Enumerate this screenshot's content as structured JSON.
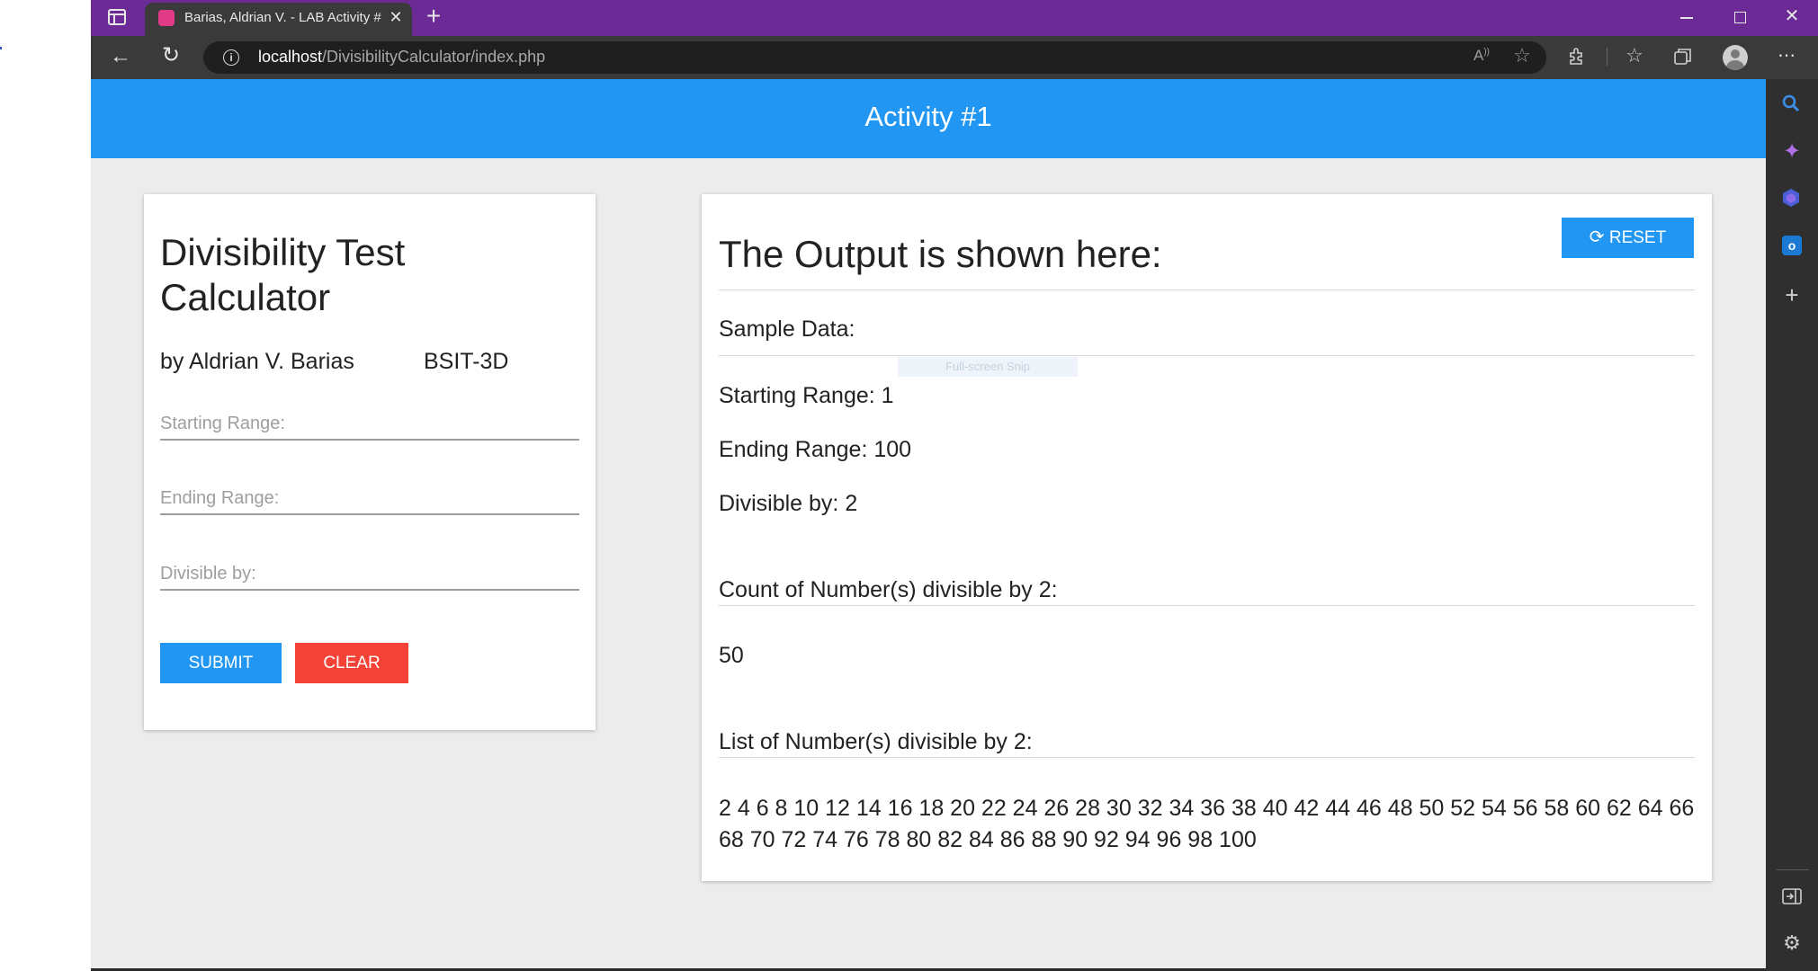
{
  "browser": {
    "tab_title": "Barias, Aldrian V. - LAB Activity #",
    "url_host": "localhost",
    "url_path": "/DivisibilityCalculator/index.php",
    "snip_label": "Full-screen Snip"
  },
  "app": {
    "header_title": "Activity #1"
  },
  "form": {
    "title_line1": "Divisibility Test",
    "title_line2": "Calculator",
    "author": "by Aldrian V. Barias",
    "section": "BSIT-3D",
    "starting_placeholder": "Starting Range:",
    "ending_placeholder": "Ending Range:",
    "divisible_placeholder": "Divisible by:",
    "submit_label": "SUBMIT",
    "clear_label": "CLEAR"
  },
  "output": {
    "title": "The Output is shown here:",
    "reset_label": "RESET",
    "sample_heading": "Sample Data:",
    "starting": "Starting Range: 1",
    "ending": "Ending Range: 100",
    "divisible": "Divisible by: 2",
    "count_heading": "Count of Number(s) divisible by 2:",
    "count_value": "50",
    "list_heading": "List of Number(s) divisible by 2:",
    "list_line1": "2 4 6 8 10 12 14 16 18 20 22 24 26 28 30 32 34 36 38 40 42 44 46 48 50 52 54 56 58 60 62 64 66",
    "list_line2": "68 70 72 74 76 78 80 82 84 86 88 90 92 94 96 98 100"
  },
  "colors": {
    "browser_accent": "#6b2a96",
    "header_blue": "#2196f3",
    "clear_red": "#f44336"
  },
  "icons": {
    "sidebar": [
      "search-icon",
      "copilot-icon",
      "games-icon",
      "outlook-icon",
      "add-icon",
      "hide-sidebar-icon",
      "settings-icon"
    ]
  }
}
